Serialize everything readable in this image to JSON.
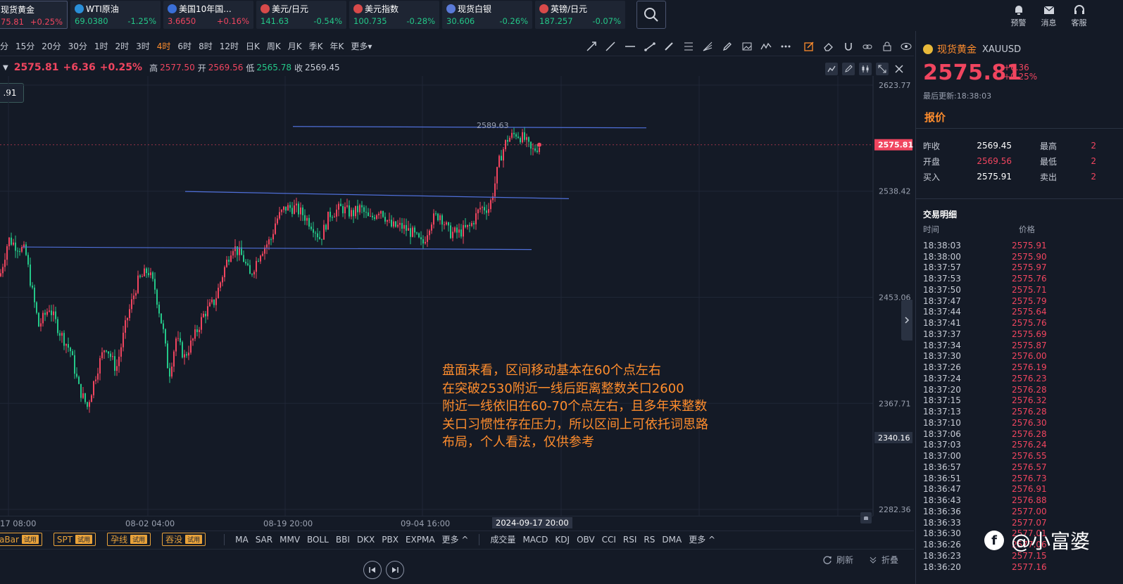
{
  "tickers": [
    {
      "name": "现货黄金",
      "price": "75.81",
      "change": "+0.25%",
      "dir": "up",
      "width": 102,
      "flag": ""
    },
    {
      "name": "WTI原油",
      "price": "69.0380",
      "change": "-1.25%",
      "dir": "down",
      "width": 128,
      "flag": "#2a8fd8"
    },
    {
      "name": "美国10年国...",
      "price": "3.6650",
      "change": "+0.16%",
      "dir": "up",
      "width": 128,
      "flag": "#3a6fd8"
    },
    {
      "name": "美元/日元",
      "price": "141.63",
      "change": "-0.54%",
      "dir": "down",
      "width": 128,
      "flag": "#d84a4a"
    },
    {
      "name": "美元指数",
      "price": "100.735",
      "change": "-0.28%",
      "dir": "down",
      "width": 128,
      "flag": "#d84a4a"
    },
    {
      "name": "现货白银",
      "price": "30.606",
      "change": "-0.26%",
      "dir": "down",
      "width": 128,
      "flag": "#5a7ad8"
    },
    {
      "name": "英镑/日元",
      "price": "187.257",
      "change": "-0.07%",
      "dir": "down",
      "width": 128,
      "flag": "#d84a4a"
    }
  ],
  "top_tools": [
    {
      "label": "预警",
      "icon": "bell-icon"
    },
    {
      "label": "消息",
      "icon": "mail-icon"
    },
    {
      "label": "客服",
      "icon": "headset-icon"
    }
  ],
  "periods": [
    "分",
    "15分",
    "20分",
    "30分",
    "1时",
    "2时",
    "3时",
    "4时",
    "6时",
    "8时",
    "12时",
    "日K",
    "周K",
    "月K",
    "季K",
    "年K",
    "更多"
  ],
  "active_period": "4时",
  "info": {
    "price": "2575.81",
    "change": "+6.36",
    "pct": "+0.25%",
    "high_label": "高",
    "high": "2577.50",
    "open_label": "开",
    "open": "2569.56",
    "low_label": "低",
    "low": "2565.78",
    "close_label": "收",
    "close": "2569.45"
  },
  "left_tag": ".91",
  "price_axis": {
    "labels": [
      "2623.77",
      "2538.42",
      "2453.06",
      "2367.71",
      "2282.36"
    ],
    "current": "2575.81",
    "alert": "2340.16",
    "peak_label": "2589.63"
  },
  "annotation": [
    "盘面来看，区间移动基本在60个点左右",
    "在突破2530附近一线后距离整数关口2600",
    "附近一线依旧在60-70个点左右，且多年来整数",
    "关口习惯性存在压力，所以区间上可依托词思路",
    "布局，个人看法，仅供参考"
  ],
  "x_axis": {
    "labels": [
      "17 08:00",
      "08-02 04:00",
      "08-19 20:00",
      "09-04 16:00"
    ],
    "highlight": "2024-09-17 20:00"
  },
  "trial_tags": [
    {
      "label": "aBar",
      "tag": "试用"
    },
    {
      "label": "SPT",
      "tag": "试用"
    },
    {
      "label": "孕线",
      "tag": "试用"
    },
    {
      "label": "吞没",
      "tag": "试用"
    }
  ],
  "main_indicators": [
    "MA",
    "SAR",
    "MMV",
    "BOLL",
    "BBI",
    "DKX",
    "PBX",
    "EXPMA",
    "更多"
  ],
  "sub_indicators": [
    "成交量",
    "MACD",
    "KDJ",
    "OBV",
    "CCI",
    "RSI",
    "RS",
    "DMA",
    "更多"
  ],
  "footer": {
    "refresh": "刷新",
    "collapse": "折叠"
  },
  "panel": {
    "name": "现货黄金",
    "code": "XAUUSD",
    "price": "2575.81",
    "change": "+6.36",
    "pct": "+0.25%",
    "updated": "最后更新:18:38:03",
    "tab": "报价",
    "quote": [
      {
        "k": "昨收",
        "v": "2569.45",
        "red": false,
        "k2": "最高",
        "v2": "2"
      },
      {
        "k": "开盘",
        "v": "2569.56",
        "red": true,
        "k2": "最低",
        "v2": "2"
      },
      {
        "k": "买入",
        "v": "2575.91",
        "red": false,
        "k2": "卖出",
        "v2": "2"
      }
    ],
    "trades_title": "交易明细",
    "trades_head": {
      "time": "时间",
      "price": "价格"
    },
    "trades": [
      [
        "18:38:03",
        "2575.91"
      ],
      [
        "18:38:00",
        "2575.90"
      ],
      [
        "18:37:57",
        "2575.97"
      ],
      [
        "18:37:53",
        "2575.76"
      ],
      [
        "18:37:50",
        "2575.71"
      ],
      [
        "18:37:47",
        "2575.79"
      ],
      [
        "18:37:44",
        "2575.64"
      ],
      [
        "18:37:41",
        "2575.76"
      ],
      [
        "18:37:37",
        "2575.69"
      ],
      [
        "18:37:34",
        "2575.87"
      ],
      [
        "18:37:30",
        "2576.00"
      ],
      [
        "18:37:26",
        "2576.19"
      ],
      [
        "18:37:24",
        "2576.23"
      ],
      [
        "18:37:20",
        "2576.28"
      ],
      [
        "18:37:15",
        "2576.32"
      ],
      [
        "18:37:13",
        "2576.28"
      ],
      [
        "18:37:10",
        "2576.30"
      ],
      [
        "18:37:06",
        "2576.28"
      ],
      [
        "18:37:03",
        "2576.24"
      ],
      [
        "18:37:00",
        "2576.55"
      ],
      [
        "18:36:57",
        "2576.57"
      ],
      [
        "18:36:51",
        "2576.73"
      ],
      [
        "18:36:47",
        "2576.91"
      ],
      [
        "18:36:43",
        "2576.88"
      ],
      [
        "18:36:36",
        "2577.00"
      ],
      [
        "18:36:33",
        "2577.07"
      ],
      [
        "18:36:30",
        "2577.01"
      ],
      [
        "18:36:26",
        "2577.06"
      ],
      [
        "18:36:23",
        "2577.15"
      ],
      [
        "18:36:20",
        "2577.16"
      ]
    ]
  },
  "watermark": "@小富婆",
  "colors": {
    "up": "#f0455f",
    "down": "#24c788",
    "accent": "#ff8d2d",
    "trendline": "#4f6fd8"
  }
}
